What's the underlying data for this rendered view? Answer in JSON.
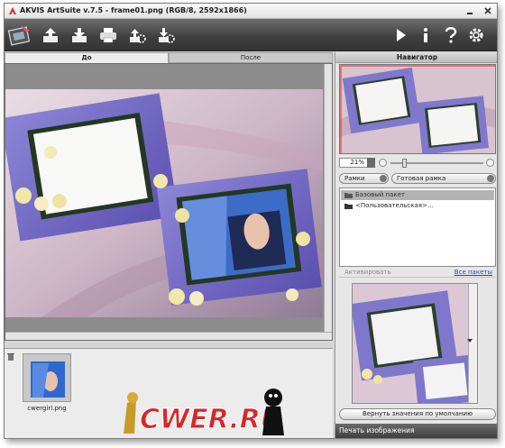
{
  "window": {
    "title": "AKVIS ArtSuite v.7.5 - frame01.png (RGB/8, 2592x1866)"
  },
  "toolbar": {
    "left_icons": [
      "app-logo-icon",
      "open-icon",
      "save-icon",
      "print-icon",
      "export-preset-icon",
      "import-preset-icon"
    ],
    "right_icons": [
      "run-icon",
      "info-icon",
      "help-icon",
      "settings-icon"
    ]
  },
  "tabs": {
    "before": "До",
    "after": "После"
  },
  "navigator": {
    "title": "Навигатор",
    "zoom": "21%"
  },
  "frames": {
    "category": "Рамки",
    "preset": "Готовая рамка",
    "packs": [
      "Базовый пакет",
      "<Пользовательская>..."
    ],
    "activate": "Активировать",
    "all_packs": "Все пакеты"
  },
  "buttons": {
    "reset": "Вернуть значения по умолчанию"
  },
  "print_panel": {
    "title": "Печать изображения"
  },
  "filmstrip": {
    "thumbnail_label": "cwergirl.png"
  },
  "watermark": {
    "text": "CWER.RU"
  },
  "colors": {
    "frame_purple": "#7a6fc4",
    "toolbar_dark": "#3a3a3a",
    "link_blue": "#1a4cb8",
    "app_red": "#d9262a"
  }
}
